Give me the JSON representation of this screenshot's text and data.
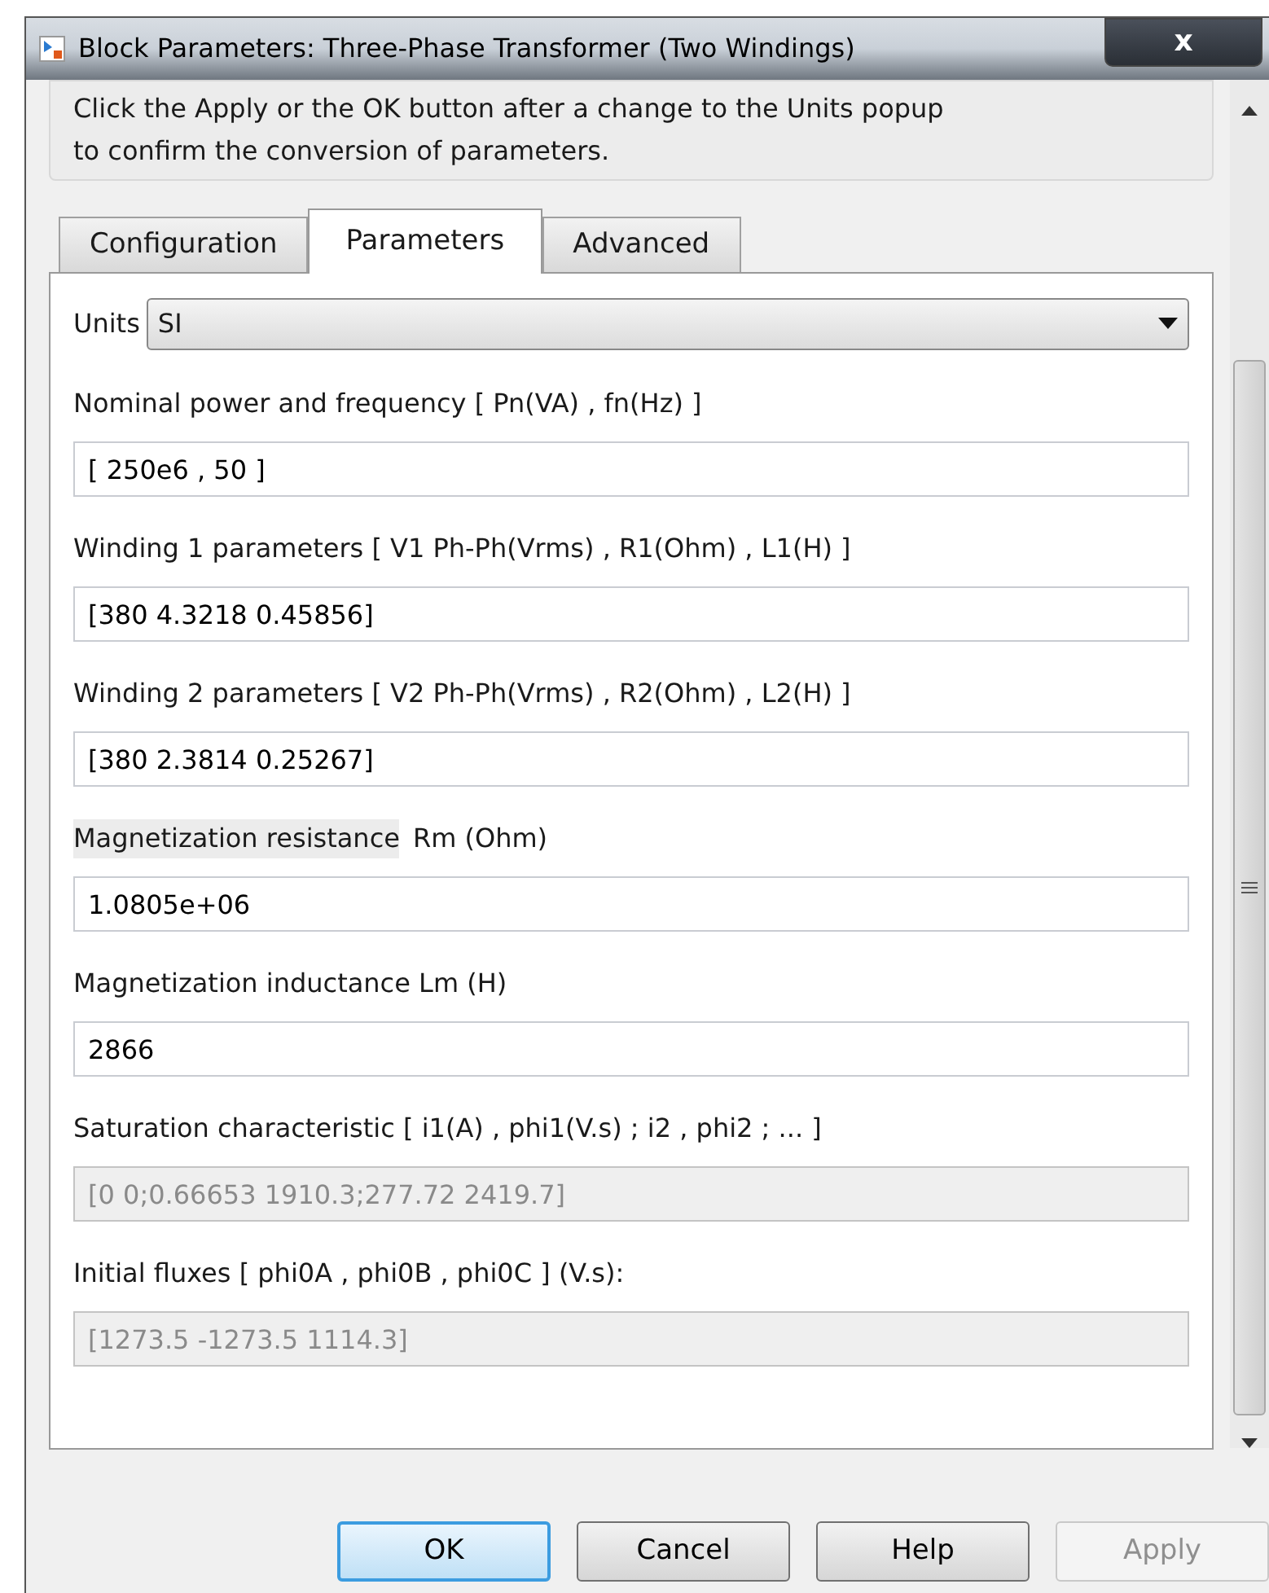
{
  "window": {
    "title": "Block Parameters: Three-Phase Transformer (Two Windings)",
    "close": "x"
  },
  "info": {
    "lines": [
      "Click the Apply or the OK button after a change to the Units popup",
      "to confirm the conversion of parameters."
    ]
  },
  "tabs": [
    {
      "label": "Configuration",
      "selected": false
    },
    {
      "label": "Parameters",
      "selected": true
    },
    {
      "label": "Advanced",
      "selected": false
    }
  ],
  "units": {
    "label": "Units",
    "value": "SI"
  },
  "fields": [
    {
      "label": "Nominal power and frequency  [ Pn(VA) , fn(Hz) ]",
      "value": "[ 250e6 , 50 ]",
      "disabled": false
    },
    {
      "label": "Winding 1 parameters [ V1 Ph-Ph(Vrms) , R1(Ohm) , L1(H) ]",
      "value": "[380 4.3218 0.45856]",
      "disabled": false
    },
    {
      "label": "Winding 2 parameters [ V2 Ph-Ph(Vrms) , R2(Ohm) , L2(H) ]",
      "value": "[380 2.3814 0.25267]",
      "disabled": false
    },
    {
      "label": "Magnetization resistance",
      "label_extra": "Rm (Ohm)",
      "highlighted": true,
      "value": "1.0805e+06",
      "disabled": false
    },
    {
      "label": "Magnetization inductance  Lm (H)",
      "value": "2866",
      "disabled": false
    },
    {
      "label": "Saturation characteristic [ i1(A) ,  phi1(V.s) ;  i2 , phi2 ; ... ]",
      "value": "[0 0;0.66653 1910.3;277.72 2419.7]",
      "disabled": true
    },
    {
      "label": "Initial fluxes [ phi0A , phi0B , phi0C ] (V.s):",
      "value": "[1273.5 -1273.5 1114.3]",
      "disabled": true
    }
  ],
  "buttons": [
    {
      "label": "OK",
      "default": true,
      "disabled": false
    },
    {
      "label": "Cancel",
      "default": false,
      "disabled": false
    },
    {
      "label": "Help",
      "default": false,
      "disabled": false
    },
    {
      "label": "Apply",
      "default": false,
      "disabled": true
    }
  ]
}
